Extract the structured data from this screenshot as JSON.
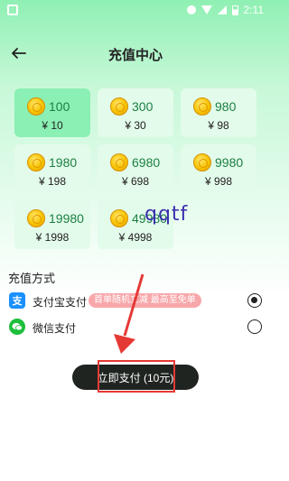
{
  "status_bar": {
    "time": "2:11"
  },
  "header": {
    "title": "充值中心"
  },
  "packages": [
    {
      "amount": "100",
      "price": "¥ 10",
      "selected": true
    },
    {
      "amount": "300",
      "price": "¥ 30",
      "selected": false
    },
    {
      "amount": "980",
      "price": "¥ 98",
      "selected": false
    },
    {
      "amount": "1980",
      "price": "¥ 198",
      "selected": false
    },
    {
      "amount": "6980",
      "price": "¥ 698",
      "selected": false
    },
    {
      "amount": "9980",
      "price": "¥ 998",
      "selected": false
    },
    {
      "amount": "19980",
      "price": "¥ 1998",
      "selected": false
    },
    {
      "amount": "49980",
      "price": "¥ 4998",
      "selected": false
    }
  ],
  "watermark": "qqtf",
  "payment": {
    "section_title": "充值方式",
    "alipay": {
      "label": "支付宝支付",
      "promo": "首单随机立减 最高至免单",
      "selected": true,
      "icon": "alipay-icon"
    },
    "wechat": {
      "label": "微信支付",
      "selected": false,
      "icon": "wechat-icon"
    }
  },
  "pay_button": {
    "label": "立即支付 (10元)"
  },
  "colors": {
    "accent": "#8af0b3",
    "amount_text": "#1b7f43",
    "button": "#1f2421",
    "annotation": "#e53935"
  }
}
